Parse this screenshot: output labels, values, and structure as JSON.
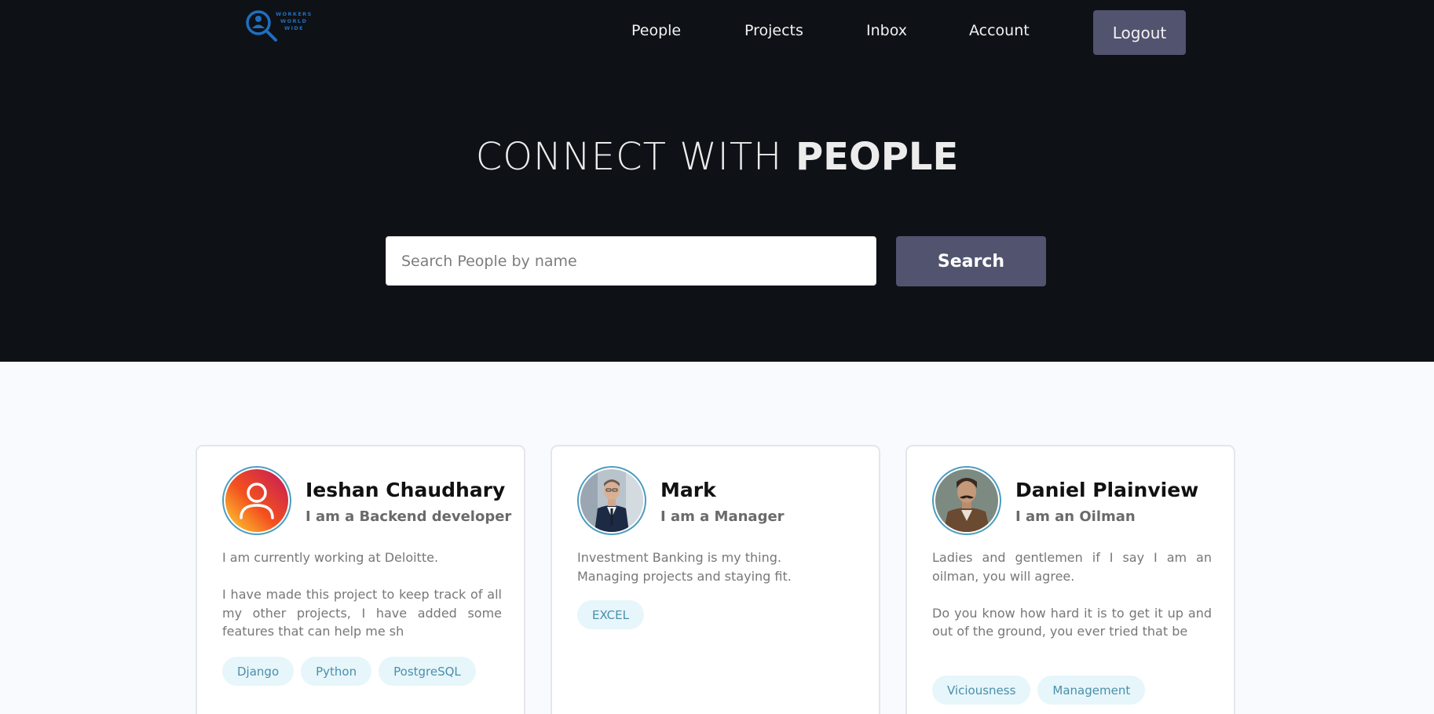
{
  "nav": {
    "logo_text": "WORKERS WORLD WIDE",
    "links": [
      "People",
      "Projects",
      "Inbox",
      "Account"
    ],
    "logout_label": "Logout"
  },
  "hero": {
    "title_light": "CONNECT WITH",
    "title_bold": "PEOPLE",
    "search_placeholder": "Search People by name",
    "search_value": "",
    "search_button": "Search"
  },
  "colors": {
    "hero_bg": "#0e1116",
    "button_bg": "#51536f",
    "page_bg": "#f8fafe",
    "tag_bg": "#e6f6fb",
    "tag_text": "#4b8fa8",
    "avatar_ring": "#4b9cc0"
  },
  "profiles": [
    {
      "name": "Ieshan Chaudhary",
      "role": "I am a Backend developer",
      "avatar_icon": "user-gradient-icon",
      "bio": [
        "I am currently working at Deloitte.",
        "I have made this project to keep track of all my other projects, I have added some features that can help me sh"
      ],
      "skills": [
        "Django",
        "Python",
        "PostgreSQL"
      ]
    },
    {
      "name": "Mark",
      "role": "I am a Manager",
      "avatar_icon": "businessman-photo",
      "bio": [
        "Investment Banking is my thing. Managing projects and staying fit."
      ],
      "skills": [
        "EXCEL"
      ]
    },
    {
      "name": "Daniel Plainview",
      "role": "I am an Oilman",
      "avatar_icon": "mustache-man-photo",
      "bio": [
        "Ladies and gentlemen if I say I am an oilman, you will agree.",
        "Do you know how hard it is to get it up and out of the ground, you ever tried that be"
      ],
      "skills": [
        "Viciousness",
        "Management"
      ]
    }
  ]
}
